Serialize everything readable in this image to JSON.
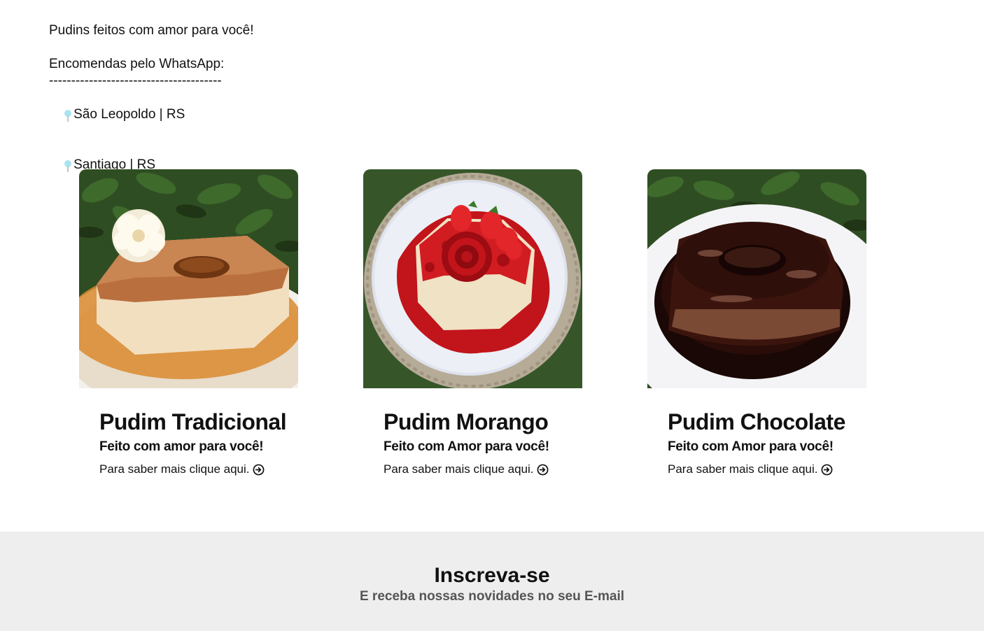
{
  "intro": {
    "tagline": "Pudins feitos com amor para você!",
    "orders": "Encomendas pelo WhatsApp:",
    "divider": "---------------------------------------",
    "locations": [
      {
        "icon": "pin-icon",
        "label": "São Leopoldo | RS"
      },
      {
        "icon": "pin-icon",
        "label": "Santiago | RS"
      }
    ]
  },
  "products": [
    {
      "title": "Pudim Tradicional",
      "subtitle": "Feito com amor para você!",
      "link": "Para saber mais clique aqui.",
      "link_icon": "arrow-right-circle-icon"
    },
    {
      "title": "Pudim Morango",
      "subtitle": "Feito com Amor para você!",
      "link": "Para saber mais clique aqui.",
      "link_icon": "arrow-right-circle-icon"
    },
    {
      "title": "Pudim Chocolate",
      "subtitle": "Feito com Amor para você!",
      "link": "Para saber mais clique aqui.",
      "link_icon": "arrow-right-circle-icon"
    }
  ],
  "newsletter": {
    "title": "Inscreva-se",
    "subtitle": "E receba nossas novidades no seu E-mail"
  },
  "colors": {
    "footer_bg": "#eeeeee",
    "pin": "#a9e4f2"
  }
}
